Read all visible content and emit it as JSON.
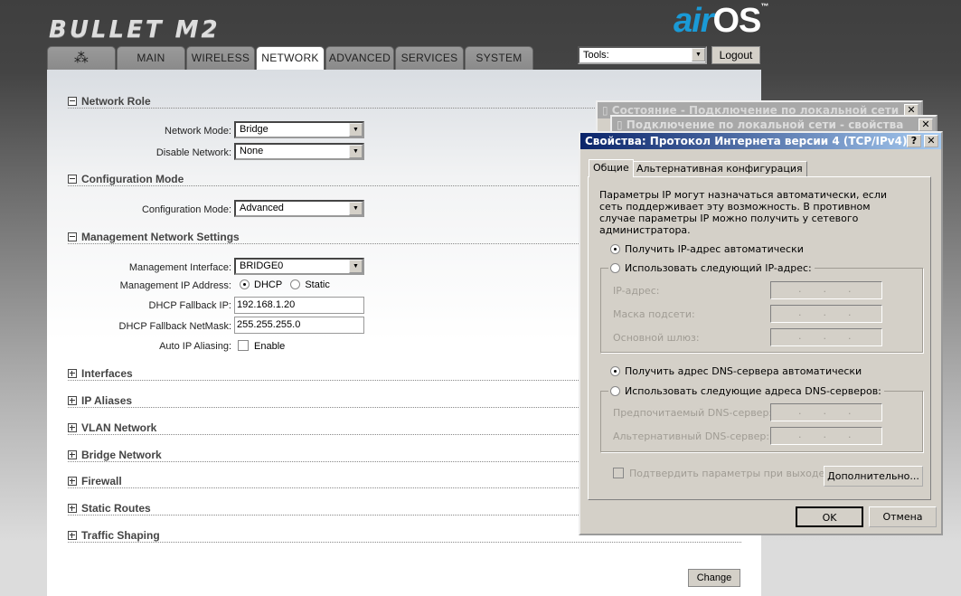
{
  "header": {
    "logo": "BULLET M2",
    "brand_air": "air",
    "brand_os": "OS",
    "tm": "™",
    "tools_select": "Tools:",
    "logout": "Logout"
  },
  "tabs": [
    {
      "label": "",
      "icon": "ubiquiti-logo-icon"
    },
    {
      "label": "MAIN"
    },
    {
      "label": "WIRELESS"
    },
    {
      "label": "NETWORK"
    },
    {
      "label": "ADVANCED"
    },
    {
      "label": "SERVICES"
    },
    {
      "label": "SYSTEM"
    }
  ],
  "network_role": {
    "title": "Network Role",
    "network_mode_label": "Network Mode:",
    "network_mode": "Bridge",
    "disable_network_label": "Disable Network:",
    "disable_network": "None"
  },
  "configuration_mode": {
    "title": "Configuration Mode",
    "label": "Configuration Mode:",
    "value": "Advanced"
  },
  "management": {
    "title": "Management Network Settings",
    "interface_label": "Management Interface:",
    "interface": "BRIDGE0",
    "ip_label": "Management IP Address:",
    "dhcp": "DHCP",
    "static": "Static",
    "fallback_ip_label": "DHCP Fallback IP:",
    "fallback_ip": "192.168.1.20",
    "fallback_mask_label": "DHCP Fallback NetMask:",
    "fallback_mask": "255.255.255.0",
    "aliasing_label": "Auto IP Aliasing:",
    "aliasing_enable": "Enable"
  },
  "collapsed_sections": [
    "Interfaces",
    "IP Aliases",
    "VLAN Network",
    "Bridge Network",
    "Firewall",
    "Static Routes",
    "Traffic Shaping"
  ],
  "change_button": "Change",
  "bg_windows": {
    "status_title": "Состояние - Подключение по локальной сети",
    "props_title": "Подключение по локальной сети - свойства"
  },
  "dialog": {
    "title": "Свойства: Протокол Интернета версии 4 (TCP/IPv4)",
    "help": "?",
    "close": "✕",
    "tabs": [
      "Общие",
      "Альтернативная конфигурация"
    ],
    "description": "Параметры IP могут назначаться автоматически, если сеть поддерживает эту возможность. В противном случае параметры IP можно получить у сетевого администратора.",
    "ip_auto": "Получить IP-адрес автоматически",
    "ip_manual": "Использовать следующий IP-адрес:",
    "ip_label": "IP-адрес:",
    "mask_label": "Маска подсети:",
    "gateway_label": "Основной шлюз:",
    "dns_auto": "Получить адрес DNS-сервера автоматически",
    "dns_manual": "Использовать следующие адреса DNS-серверов:",
    "dns_pref_label": "Предпочитаемый DNS-сервер:",
    "dns_alt_label": "Альтернативный DNS-сервер:",
    "validate": "Подтвердить параметры при выходе",
    "advanced": "Дополнительно...",
    "ok": "OK",
    "cancel": "Отмена",
    "ip_placeholder": "..."
  }
}
